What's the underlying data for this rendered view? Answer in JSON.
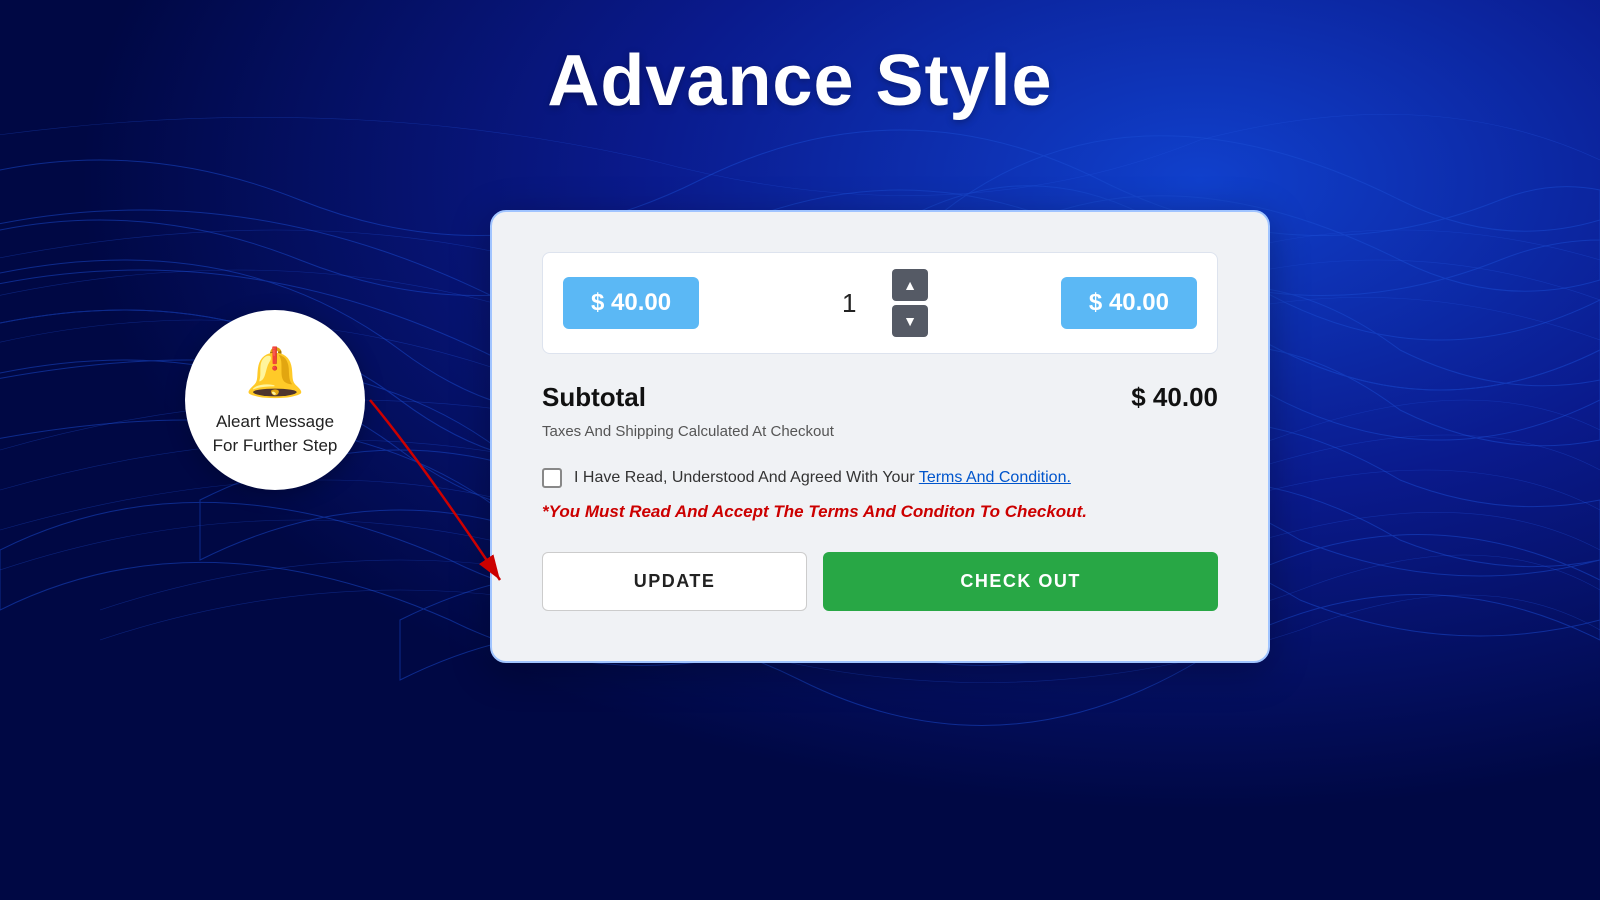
{
  "page": {
    "title": "Advance Style",
    "background_color": "#0a1a8c"
  },
  "alert_bubble": {
    "icon": "🔔",
    "line1": "Aleart Message",
    "line2": "For Further Step"
  },
  "product_row": {
    "unit_price": "$ 40.00",
    "quantity": "1",
    "total_price": "$ 40.00"
  },
  "subtotal": {
    "label": "Subtotal",
    "value": "$ 40.00",
    "tax_note": "Taxes And Shipping Calculated At Checkout"
  },
  "terms": {
    "text": "I Have Read, Understood And Agreed With Your ",
    "link_text": "Terms And Condition.",
    "checked": false
  },
  "alert_text": "*You Must Read And Accept The Terms And Conditon To Checkout.",
  "buttons": {
    "update_label": "UPDATE",
    "checkout_label": "CHECK OUT"
  },
  "qty_up_label": "▲",
  "qty_down_label": "▼"
}
